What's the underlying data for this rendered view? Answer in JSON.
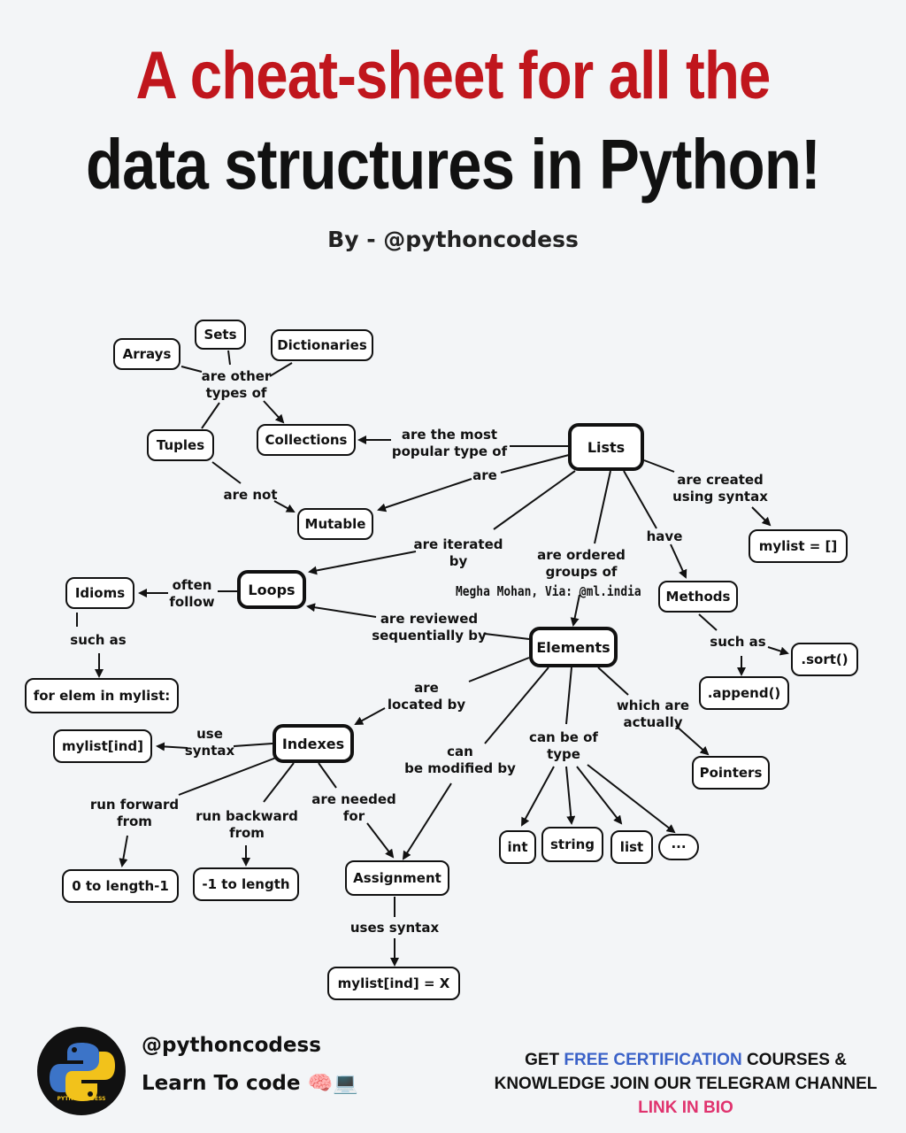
{
  "header": {
    "title_line1": "A cheat-sheet for all the",
    "title_line2": "data structures in Python!",
    "byline": "By - @pythoncodess"
  },
  "diagram": {
    "nodes": {
      "sets": "Sets",
      "arrays": "Arrays",
      "dictionaries": "Dictionaries",
      "tuples": "Tuples",
      "collections": "Collections",
      "lists": "Lists",
      "mutable": "Mutable",
      "mylist_syntax": "mylist = []",
      "loops": "Loops",
      "idioms": "Idioms",
      "methods": "Methods",
      "for_elem": "for elem in mylist:",
      "elements": "Elements",
      "sort": ".sort()",
      "append": ".append()",
      "mylist_ind": "mylist[ind]",
      "indexes": "Indexes",
      "pointers": "Pointers",
      "int": "int",
      "string": "string",
      "list": "list",
      "ellipsis": "···",
      "zero_to_len": "0 to length-1",
      "neg1_to_len": "-1 to length",
      "assignment": "Assignment",
      "mylist_ind_x": "mylist[ind] = X"
    },
    "labels": {
      "are_other_types_of": "are other\ntypes of",
      "are_most_popular": "are the most\npopular type of",
      "are": "are",
      "are_not": "are not",
      "are_created_using": "are created\nusing syntax",
      "are_iterated_by": "are iterated\nby",
      "are_ordered_groups": "are ordered\ngroups of",
      "have": "have",
      "often_follow": "often\nfollow",
      "such_as_1": "such as",
      "are_reviewed": "are reviewed\nsequentially by",
      "such_as_2": "such as",
      "are_located_by": "are\nlocated by",
      "which_are_actually": "which are\nactually",
      "use_syntax": "use\nsyntax",
      "can_be_modified_by": "can\nbe modified by",
      "can_be_of_type": "can be of\ntype",
      "run_forward_from": "run forward\nfrom",
      "run_backward_from": "run backward\nfrom",
      "are_needed_for": "are needed\nfor",
      "uses_syntax": "uses syntax"
    },
    "credit": "Megha Mohan, Via: @ml.india"
  },
  "footer": {
    "logo_text": "PYTHONCODESS",
    "handle": "@pythoncodess",
    "tagline": "Learn To code 🧠💻",
    "promo_get": "GET ",
    "promo_free": "FREE CERTIFICATION",
    "promo_courses": " COURSES &",
    "promo_line2": "KNOWLEDGE JOIN OUR TELEGRAM CHANNEL",
    "promo_link": "LINK IN BIO"
  }
}
